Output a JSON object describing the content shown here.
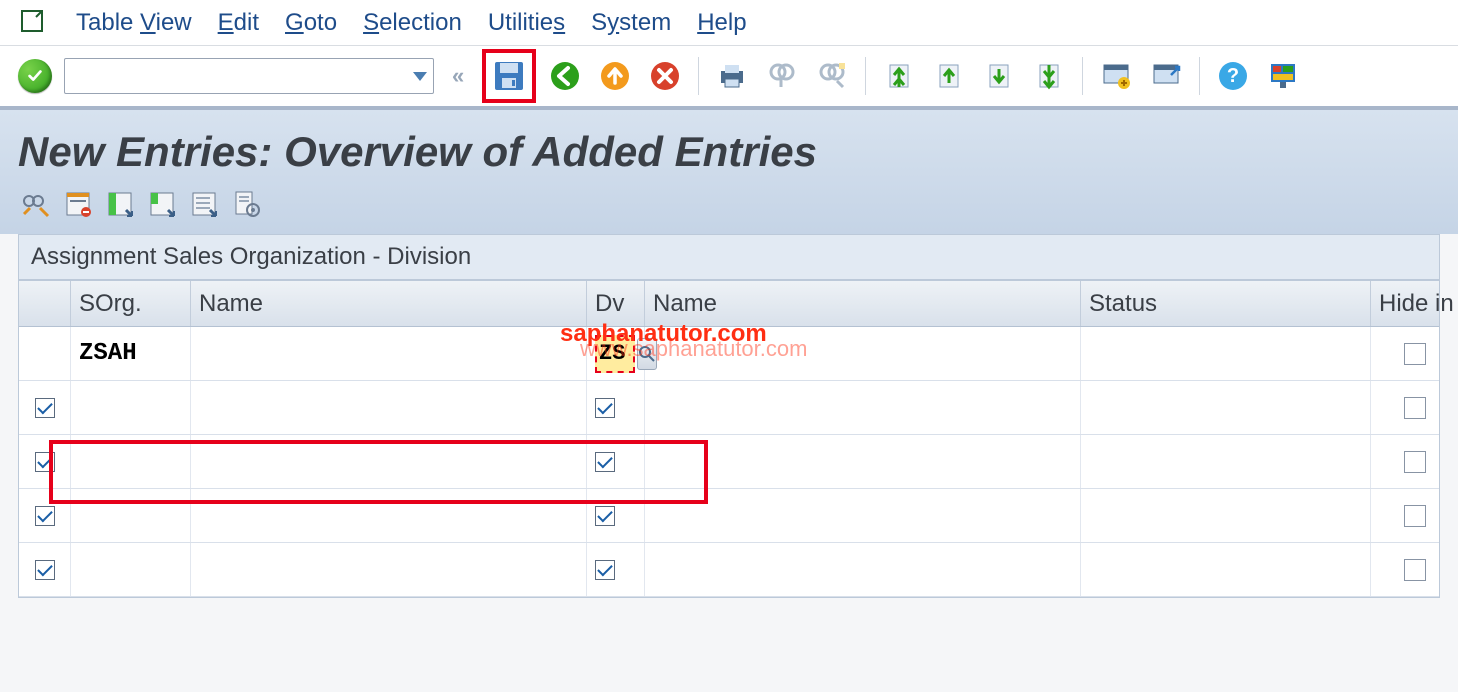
{
  "menu": {
    "items": [
      "Table View",
      "Edit",
      "Goto",
      "Selection",
      "Utilities",
      "System",
      "Help"
    ],
    "mnemonic_positions": [
      6,
      0,
      0,
      0,
      7,
      1,
      0
    ]
  },
  "toolbar": {
    "command_value": "",
    "save_highlighted": true,
    "icons": [
      "save",
      "back",
      "exit",
      "cancel",
      "print",
      "find",
      "find-next",
      "first-page",
      "prev-page",
      "next-page",
      "last-page",
      "new-session",
      "generate-shortcut",
      "help",
      "layout"
    ]
  },
  "page": {
    "title": "New Entries: Overview of Added Entries",
    "subtitle": "Assignment Sales Organization - Division"
  },
  "watermark": {
    "line1": "saphanatutor.com",
    "line2": "www.saphanatutor.com"
  },
  "app_toolbar": [
    "display-change",
    "delimit",
    "select-all",
    "select-block",
    "deselect-all",
    "config"
  ],
  "table": {
    "columns": [
      "SOrg.",
      "Name",
      "Dv",
      "Name",
      "Status",
      "Hide in"
    ],
    "rows": [
      {
        "sorg": "ZSAH",
        "name1": "",
        "dv": "ZS",
        "name2": "",
        "status": "",
        "hide": false,
        "sel": false,
        "show_f4": true
      },
      {
        "sorg": "",
        "name1": "",
        "dv": "",
        "name2": "",
        "status": "",
        "hide": false,
        "sel": true
      },
      {
        "sorg": "",
        "name1": "",
        "dv": "",
        "name2": "",
        "status": "",
        "hide": false,
        "sel": true
      },
      {
        "sorg": "",
        "name1": "",
        "dv": "",
        "name2": "",
        "status": "",
        "hide": false,
        "sel": true
      },
      {
        "sorg": "",
        "name1": "",
        "dv": "",
        "name2": "",
        "status": "",
        "hide": false,
        "sel": true
      }
    ]
  }
}
